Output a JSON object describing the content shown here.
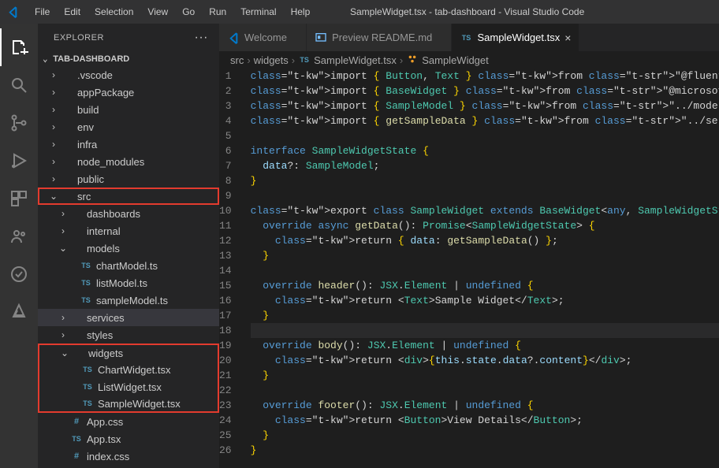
{
  "titlebar": {
    "menu": [
      "File",
      "Edit",
      "Selection",
      "View",
      "Go",
      "Run",
      "Terminal",
      "Help"
    ],
    "title": "SampleWidget.tsx - tab-dashboard - Visual Studio Code"
  },
  "activitybar": {
    "items": [
      "files",
      "search",
      "source-control",
      "run-debug",
      "extensions",
      "teams",
      "teams-toolkit",
      "azure"
    ]
  },
  "sidebar": {
    "header": "EXPLORER",
    "section": "TAB-DASHBOARD",
    "tree": [
      {
        "indent": 1,
        "name": ".vscode",
        "kind": "folder",
        "open": false
      },
      {
        "indent": 1,
        "name": "appPackage",
        "kind": "folder",
        "open": false
      },
      {
        "indent": 1,
        "name": "build",
        "kind": "folder",
        "open": false
      },
      {
        "indent": 1,
        "name": "env",
        "kind": "folder",
        "open": false
      },
      {
        "indent": 1,
        "name": "infra",
        "kind": "folder",
        "open": false
      },
      {
        "indent": 1,
        "name": "node_modules",
        "kind": "folder",
        "open": false
      },
      {
        "indent": 1,
        "name": "public",
        "kind": "folder",
        "open": false
      },
      {
        "indent": 1,
        "name": "src",
        "kind": "folder",
        "open": true,
        "hl": "src"
      },
      {
        "indent": 2,
        "name": "dashboards",
        "kind": "folder",
        "open": false
      },
      {
        "indent": 2,
        "name": "internal",
        "kind": "folder",
        "open": false
      },
      {
        "indent": 2,
        "name": "models",
        "kind": "folder",
        "open": true
      },
      {
        "indent": 3,
        "name": "chartModel.ts",
        "kind": "ts"
      },
      {
        "indent": 3,
        "name": "listModel.ts",
        "kind": "ts"
      },
      {
        "indent": 3,
        "name": "sampleModel.ts",
        "kind": "ts"
      },
      {
        "indent": 2,
        "name": "services",
        "kind": "folder",
        "open": false,
        "selected": true
      },
      {
        "indent": 2,
        "name": "styles",
        "kind": "folder",
        "open": false
      },
      {
        "indent": 2,
        "name": "widgets",
        "kind": "folder",
        "open": true,
        "hl": "wtop"
      },
      {
        "indent": 3,
        "name": "ChartWidget.tsx",
        "kind": "ts",
        "hl": "wmid"
      },
      {
        "indent": 3,
        "name": "ListWidget.tsx",
        "kind": "ts",
        "hl": "wmid"
      },
      {
        "indent": 3,
        "name": "SampleWidget.tsx",
        "kind": "ts",
        "hl": "wbot"
      },
      {
        "indent": 2,
        "name": "App.css",
        "kind": "css"
      },
      {
        "indent": 2,
        "name": "App.tsx",
        "kind": "ts"
      },
      {
        "indent": 2,
        "name": "index.css",
        "kind": "css"
      }
    ]
  },
  "tabs": [
    {
      "icon": "vscode",
      "label": "Welcome",
      "active": false
    },
    {
      "icon": "preview",
      "label": "Preview README.md",
      "active": false
    },
    {
      "icon": "ts",
      "label": "SampleWidget.tsx",
      "active": true
    }
  ],
  "breadcrumb": [
    {
      "label": "src"
    },
    {
      "label": "widgets"
    },
    {
      "label": "SampleWidget.tsx",
      "icon": "ts"
    },
    {
      "label": "SampleWidget",
      "icon": "class"
    }
  ],
  "code": [
    "import { Button, Text } from \"@fluentui/react-components\";",
    "import { BaseWidget } from \"@microsoft/teamsfx-react\";",
    "import { SampleModel } from \"../models/sampleModel\";",
    "import { getSampleData } from \"../services/sampleService\";",
    "",
    "interface SampleWidgetState {",
    "  data?: SampleModel;",
    "}",
    "",
    "export class SampleWidget extends BaseWidget<any, SampleWidgetState> {",
    "  override async getData(): Promise<SampleWidgetState> {",
    "    return { data: getSampleData() };",
    "  }",
    "",
    "  override header(): JSX.Element | undefined {",
    "    return <Text>Sample Widget</Text>;",
    "  }",
    "",
    "  override body(): JSX.Element | undefined {",
    "    return <div>{this.state.data?.content}</div>;",
    "  }",
    "",
    "  override footer(): JSX.Element | undefined {",
    "    return <Button>View Details</Button>;",
    "  }",
    "}"
  ]
}
